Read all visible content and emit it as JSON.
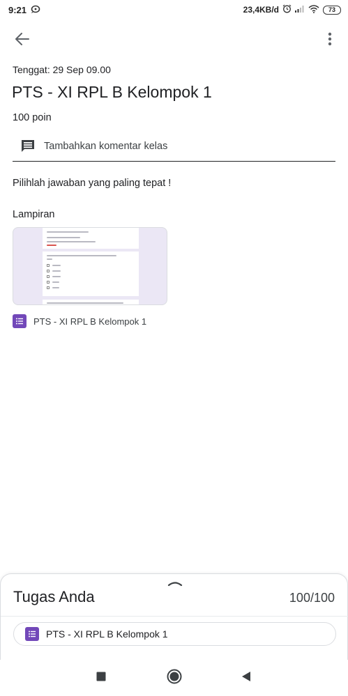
{
  "status_bar": {
    "time": "9:21",
    "network_speed": "23,4KB/d",
    "battery": "73",
    "icons": [
      "chat-notification-icon",
      "alarm-icon",
      "signal-icon",
      "wifi-icon",
      "battery-icon"
    ]
  },
  "top_bar": {
    "icons": [
      "back-arrow-icon",
      "more-vert-icon"
    ]
  },
  "assignment": {
    "due": "Tenggat: 29 Sep 09.00",
    "title": "PTS - XI RPL B Kelompok 1",
    "points": "100 poin",
    "class_comment_label": "Tambahkan komentar kelas",
    "instructions": "Pilihlah jawaban yang paling tepat !"
  },
  "attachments": {
    "heading": "Lampiran",
    "items": [
      {
        "label": "PTS - XI RPL B Kelompok 1",
        "icon": "google-forms-icon"
      }
    ]
  },
  "your_work": {
    "title": "Tugas Anda",
    "score": "100/100",
    "handle_icon": "chevron-up-icon",
    "attachment": {
      "label": "PTS - XI RPL B Kelompok 1",
      "icon": "google-forms-icon"
    }
  },
  "nav_bar": {
    "icons": [
      "recents-square-icon",
      "home-circle-icon",
      "back-triangle-icon"
    ]
  },
  "colors": {
    "forms_purple": "#7248b9",
    "thumbnail_bg": "#ebe7f5",
    "text_primary": "#202124",
    "divider": "#dadce0"
  }
}
